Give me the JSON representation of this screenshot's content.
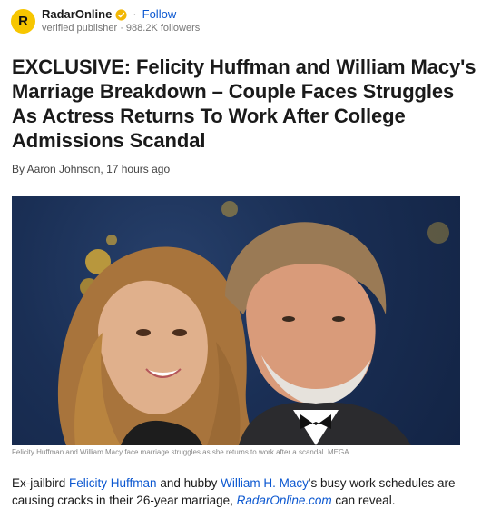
{
  "publisher": {
    "logo_letter": "R",
    "name": "RadarOnline",
    "separator": "·",
    "follow_label": "Follow",
    "subtitle": "verified publisher · 988.2K followers"
  },
  "article": {
    "headline": "EXCLUSIVE: Felicity Huffman and William Macy's Marriage Breakdown – Couple Faces Struggles As Actress Returns To Work After College Admissions Scandal",
    "byline": "By Aaron Johnson, 17 hours ago",
    "image_caption": "Felicity Huffman and William Macy face marriage struggles as she returns to work after a scandal. MEGA",
    "body": {
      "part1": "Ex-jailbird ",
      "link1": "Felicity Huffman",
      "part2": " and hubby ",
      "link2": "William H. Macy",
      "part3": "'s busy work schedules are causing cracks in their 26-year marriage, ",
      "link3": "RadarOnline.com",
      "part4": " can reveal."
    }
  },
  "colors": {
    "accent": "#0b57d0",
    "logo_bg": "#f7c600",
    "photo_bg": "#1a2f55"
  },
  "icons": {
    "verified": "verified-badge-icon"
  }
}
